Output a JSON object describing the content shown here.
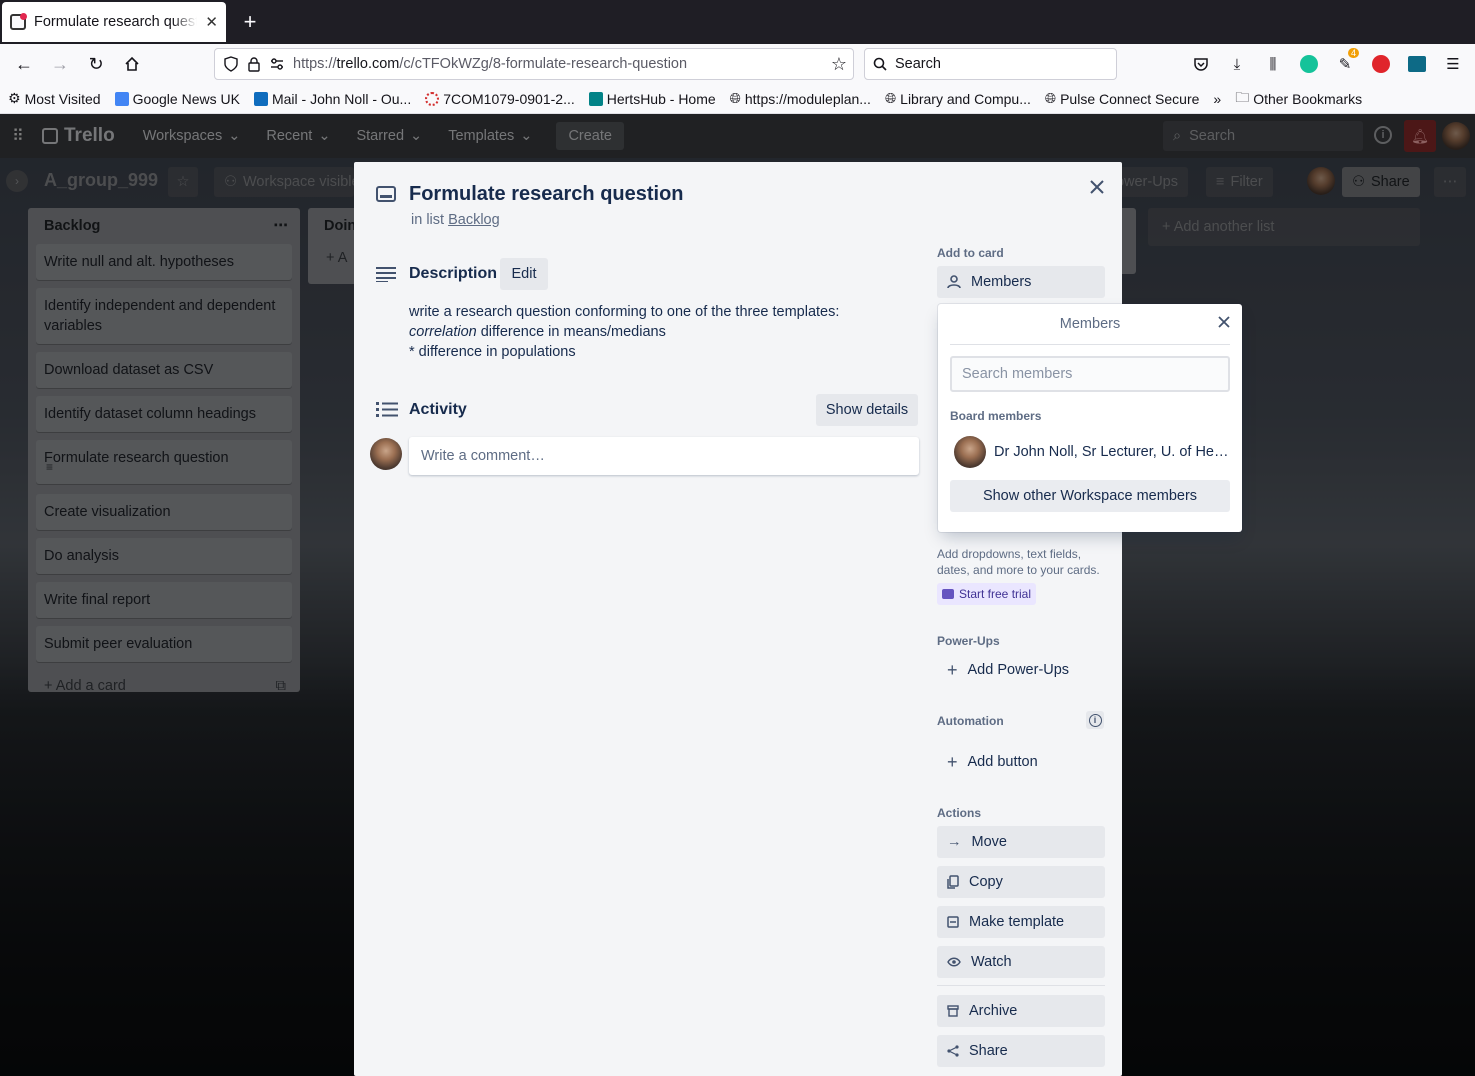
{
  "browser": {
    "tab_title": "Formulate research question",
    "url_prefix": "https://",
    "url_domain": "trello.com",
    "url_path": "/c/cTFOkWZg/8-formulate-research-question",
    "search_placeholder": "Search",
    "bookmarks": [
      {
        "label": "Most Visited",
        "icon": "gear-icon"
      },
      {
        "label": "Google News UK",
        "icon": "google-news-icon"
      },
      {
        "label": "Mail - John Noll - Ou...",
        "icon": "outlook-icon"
      },
      {
        "label": "7COM1079-0901-2...",
        "icon": "ring-icon"
      },
      {
        "label": "HertsHub - Home",
        "icon": "sharepoint-icon"
      },
      {
        "label": "https://moduleplan...",
        "icon": "globe-icon"
      },
      {
        "label": "Library and Compu...",
        "icon": "globe-icon"
      },
      {
        "label": "Pulse Connect Secure",
        "icon": "globe-icon"
      }
    ],
    "other_bookmarks": "Other Bookmarks",
    "extension_badge": "4"
  },
  "trello": {
    "logo": "Trello",
    "menu": [
      "Workspaces",
      "Recent",
      "Starred",
      "Templates"
    ],
    "create": "Create",
    "search_placeholder": "Search",
    "board_title": "A_group_999",
    "workspace_visible": "Workspace visible",
    "powerups": "Power-Ups",
    "filter": "Filter",
    "share": "Share",
    "add_list": "+ Add another list",
    "backlog": {
      "title": "Backlog",
      "cards": [
        "Write null and alt. hypotheses",
        "Identify independent and dependent variables",
        "Download dataset as CSV",
        "Identify dataset column headings",
        "Formulate research question",
        "Create visualization",
        "Do analysis",
        "Write final report",
        "Submit peer evaluation"
      ],
      "add_card": "Add a card"
    },
    "doing": {
      "title": "Doin",
      "add": "+ A"
    }
  },
  "card": {
    "title": "Formulate research question",
    "in_list_prefix": "in list ",
    "list_name": "Backlog",
    "description_title": "Description",
    "edit": "Edit",
    "description_line1": "write a research question conforming to one of the three templates:",
    "description_line2_em": "correlation",
    "description_line2_rest": " difference in means/medians",
    "description_line3": "* difference in populations",
    "activity_title": "Activity",
    "show_details": "Show details",
    "comment_placeholder": "Write a comment…"
  },
  "sidebar": {
    "add_to_card": "Add to card",
    "members": "Members",
    "hint": "Add dropdowns, text fields, dates, and more to your cards.",
    "start_trial": "Start free trial",
    "powerups_label": "Power-Ups",
    "add_powerups": "Add Power-Ups",
    "automation_label": "Automation",
    "add_button": "Add button",
    "actions_label": "Actions",
    "actions": [
      "Move",
      "Copy",
      "Make template",
      "Watch"
    ],
    "archive": "Archive",
    "share": "Share"
  },
  "members_popover": {
    "title": "Members",
    "search_placeholder": "Search members",
    "board_members_label": "Board members",
    "member_name": "Dr John Noll, Sr Lecturer, U. of Hertf...",
    "show_other": "Show other Workspace members"
  }
}
